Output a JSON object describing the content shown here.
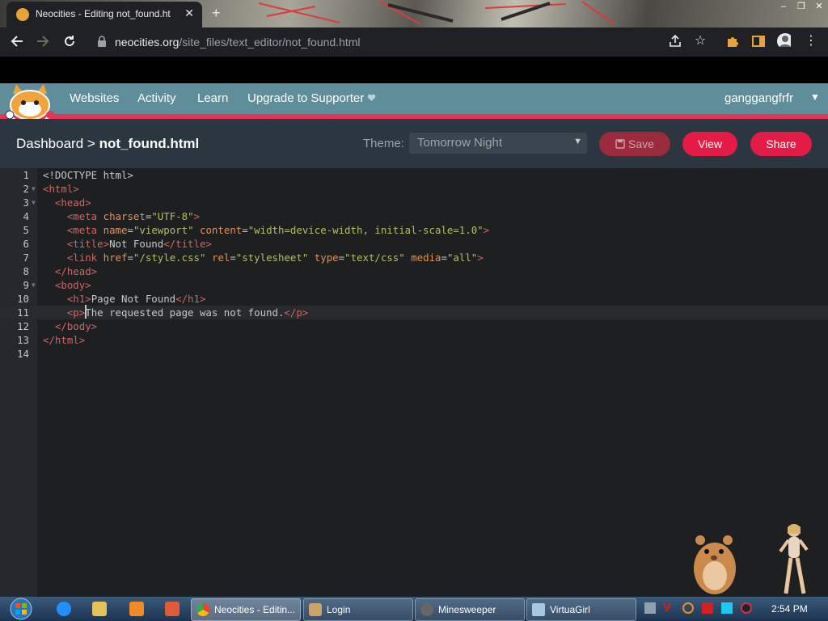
{
  "browser": {
    "tab_title": "Neocities - Editing not_found.ht",
    "tab_close": "✕",
    "new_tab": "+",
    "url_domain": "neocities.org",
    "url_path": "/site_files/text_editor/not_found.html",
    "window_controls": [
      "–",
      "❐",
      "✕"
    ]
  },
  "nav": {
    "items": [
      "Websites",
      "Activity",
      "Learn",
      "Upgrade to Supporter"
    ],
    "username": "ganggangfrfr"
  },
  "editor_header": {
    "breadcrumb_root": "Dashboard",
    "breadcrumb_sep": ">",
    "breadcrumb_file": "not_found.html",
    "theme_label": "Theme:",
    "theme_value": "Tomorrow Night",
    "save_label": "Save",
    "view_label": "View",
    "share_label": "Share"
  },
  "code": {
    "line_numbers": [
      "1",
      "2",
      "3",
      "4",
      "5",
      "6",
      "7",
      "8",
      "9",
      "10",
      "11",
      "12",
      "13",
      "14"
    ],
    "active_line": 11
  },
  "taskbar": {
    "tasks": [
      "Neocities - Editin...",
      "Login",
      "Minesweeper",
      "VirtuaGirl"
    ],
    "clock": "2:54 PM"
  },
  "colors": {
    "nav_bg": "#5f8e9a",
    "accent_red": "#e31b46",
    "editor_bg": "#1d1f21",
    "tag": "#cc6666",
    "attr": "#de935f",
    "string": "#b5bd68"
  }
}
